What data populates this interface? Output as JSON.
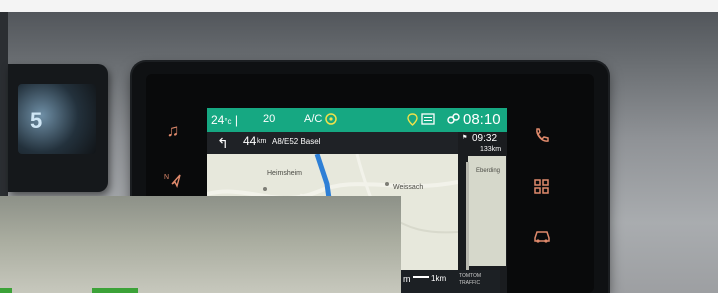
{
  "status_bar": {
    "temp_left": "24",
    "temp_left_unit": "°c",
    "temp_mid": "20",
    "ac_label": "A/C",
    "clock": "08:10"
  },
  "navigation": {
    "distance": "44",
    "distance_unit": "km",
    "road": "A8/E52 Basel",
    "eta": "09:32",
    "remaining": "133",
    "remaining_unit": "km",
    "panel_distance": "133",
    "panel_distance_unit": "km",
    "scale": "1km",
    "traffic_brand": "TOMTOM",
    "traffic_label": "TRAFFIC"
  },
  "map_labels": {
    "town_1": "Heimsheim",
    "town_2": "Weissach",
    "town_3": "Eberding"
  },
  "left_display": {
    "text": "5"
  },
  "icons": {
    "music": "music-note-icon",
    "nav": "navigation-icon",
    "phone": "phone-icon",
    "apps": "apps-grid-icon",
    "car": "car-icon"
  },
  "colors": {
    "status_green": "#16a882",
    "route_blue": "#2e7fd6",
    "button_accent": "#e08a6c"
  }
}
